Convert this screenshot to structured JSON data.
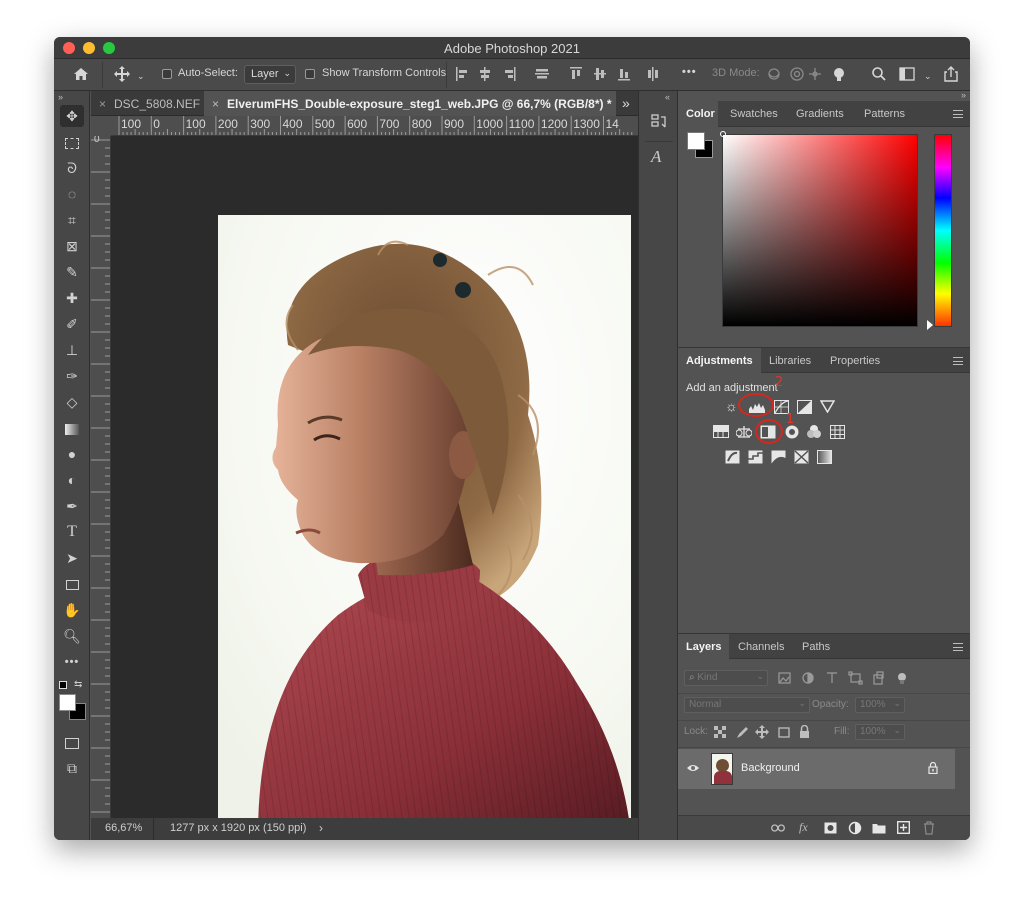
{
  "window": {
    "title": "Adobe Photoshop 2021"
  },
  "options_bar": {
    "auto_select_label": "Auto-Select:",
    "auto_select_value": "Layer",
    "show_transform_label": "Show Transform Controls",
    "more_label": "•••",
    "mode_3d_label": "3D Mode:"
  },
  "documents": {
    "tabs": [
      {
        "label": "DSC_5808.NEF",
        "close": "×"
      },
      {
        "label": "ElverumFHS_Double-exposure_steg1_web.JPG @ 66,7% (RGB/8*) *",
        "close": "×"
      }
    ],
    "overflow": "»",
    "ruler_top_ticks": [
      "100",
      "0",
      "100",
      "200",
      "300",
      "400",
      "500",
      "600",
      "700",
      "800",
      "900",
      "1000",
      "1100",
      "1200",
      "1300",
      "14"
    ],
    "ruler_left_first": "0"
  },
  "status": {
    "zoom": "66,67%",
    "info": "1277 px x 1920 px (150 ppi)",
    "arrow": "›"
  },
  "color_panel": {
    "tabs": [
      "Color",
      "Swatches",
      "Gradients",
      "Patterns"
    ],
    "active_tab": "Color",
    "foreground": "#ffffff",
    "background": "#000000",
    "hue_color": "#ff0000"
  },
  "adjustments_panel": {
    "tabs": [
      "Adjustments",
      "Libraries",
      "Properties"
    ],
    "active_tab": "Adjustments",
    "header": "Add an adjustment",
    "annotations": [
      "2",
      "1"
    ]
  },
  "layers_panel": {
    "tabs": [
      "Layers",
      "Channels",
      "Paths"
    ],
    "active_tab": "Layers",
    "kind_label": "Kind",
    "blend_mode": "Normal",
    "opacity_label": "Opacity:",
    "opacity_value": "100%",
    "lock_label": "Lock:",
    "fill_label": "Fill:",
    "fill_value": "100%",
    "layers": [
      {
        "name": "Background",
        "visible": true,
        "locked": true
      }
    ],
    "footer_fx": "fx"
  }
}
